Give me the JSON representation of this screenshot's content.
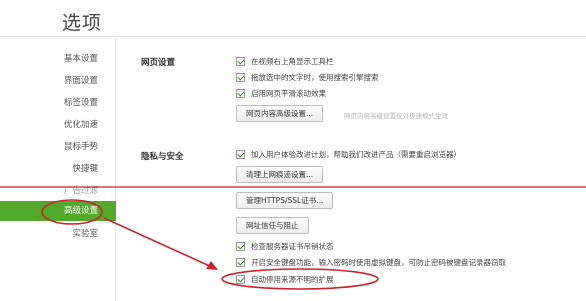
{
  "header": {
    "title": "选项"
  },
  "sidebar": {
    "items": [
      {
        "label": "基本设置"
      },
      {
        "label": "界面设置"
      },
      {
        "label": "标签设置"
      },
      {
        "label": "优化加速"
      },
      {
        "label": "鼠标手势"
      },
      {
        "label": "快捷键"
      },
      {
        "label": "广告过滤"
      },
      {
        "label": "高级设置"
      },
      {
        "label": "实验室"
      }
    ],
    "active_index": 7
  },
  "web_settings": {
    "section_label": "网页设置",
    "options": [
      {
        "label": "在视频右上角显示工具栏",
        "checked": true
      },
      {
        "label": "拖放选中的文字时，使用搜索引擎搜索",
        "checked": true
      },
      {
        "label": "启用网页平滑滚动效果",
        "checked": true
      }
    ],
    "advanced_button": "网页内容高级设置...",
    "advanced_hint": "网页内容高级设置仅对极速模式生效"
  },
  "privacy": {
    "section_label": "隐私与安全",
    "join_option": {
      "label": "加入用户体验改进计划，帮助我们改进产品（需要重启浏览器）",
      "checked": true
    },
    "clear_button": "清理上网痕迹设置...",
    "cert_button": "管理HTTPS/SSL证书...",
    "trust_button": "网址信任与阻止",
    "options": [
      {
        "label": "检查服务器证书吊销状态",
        "checked": true
      },
      {
        "label": "开启安全键盘功能，输入密码时使用虚拟键盘，可防止密码被键盘记录器窃取",
        "checked": true
      },
      {
        "label": "自动停用来源不明的扩展",
        "checked": true
      }
    ]
  },
  "colors": {
    "active_nav": "#53a92b",
    "annotation": "#c8242b"
  }
}
